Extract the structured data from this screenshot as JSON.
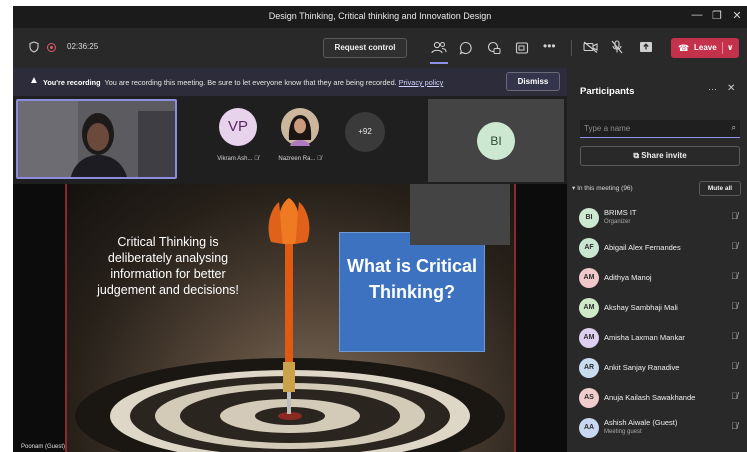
{
  "window": {
    "title": "Design Thinking, Critical thinking and Innovation Design",
    "controls": [
      "—",
      "❐",
      "✕"
    ]
  },
  "toolbar": {
    "timer": "02:36:25",
    "request_control": "Request control",
    "leave": "Leave"
  },
  "banner": {
    "title": "You're recording",
    "message": "You are recording this meeting. Be sure to let everyone know that they are being recorded.",
    "privacy_link": "Privacy policy",
    "dismiss": "Dismiss"
  },
  "stage": {
    "participants": [
      {
        "initials": "VP",
        "name": "Vikram Ash...",
        "avatar_color": "#e8d3ec",
        "text_color": "#5b2a66"
      },
      {
        "initials": "",
        "name": "Nazreen Ra...",
        "avatar_color": "#d9cbb8",
        "text_color": "#3a2a1a"
      }
    ],
    "more_count": "+92",
    "tile_initials": "BI",
    "presenter_name": "Poonam (Guest)"
  },
  "slide": {
    "left_text": "Critical Thinking is deliberately analysing information for better judgement and decisions!",
    "box_text": "What is Critical Thinking?"
  },
  "participants_panel": {
    "title": "Participants",
    "search_placeholder": "Type a name",
    "share_invite": "Share invite",
    "section": "In this meeting (96)",
    "mute_all": "Mute all",
    "people": [
      {
        "initials": "BI",
        "name": "BRIMS IT",
        "role": "Organizer",
        "color": "#cde8d0"
      },
      {
        "initials": "AF",
        "name": "Abigail Alex Fernandes",
        "role": "",
        "color": "#c8e6d0"
      },
      {
        "initials": "AM",
        "name": "Adithya Manoj",
        "role": "",
        "color": "#f0c8cc"
      },
      {
        "initials": "AM",
        "name": "Akshay Sambhaji Mali",
        "role": "",
        "color": "#cfe8c8"
      },
      {
        "initials": "AM",
        "name": "Amisha Laxman Mankar",
        "role": "",
        "color": "#dcd0ee"
      },
      {
        "initials": "AR",
        "name": "Ankit Sanjay Ranadive",
        "role": "",
        "color": "#c8dcf0"
      },
      {
        "initials": "AS",
        "name": "Anuja Kailash Sawakhande",
        "role": "",
        "color": "#f0cccc"
      },
      {
        "initials": "AA",
        "name": "Ashish Aiwale (Guest)",
        "role": "Meeting guest",
        "color": "#c8d8f0"
      }
    ]
  }
}
